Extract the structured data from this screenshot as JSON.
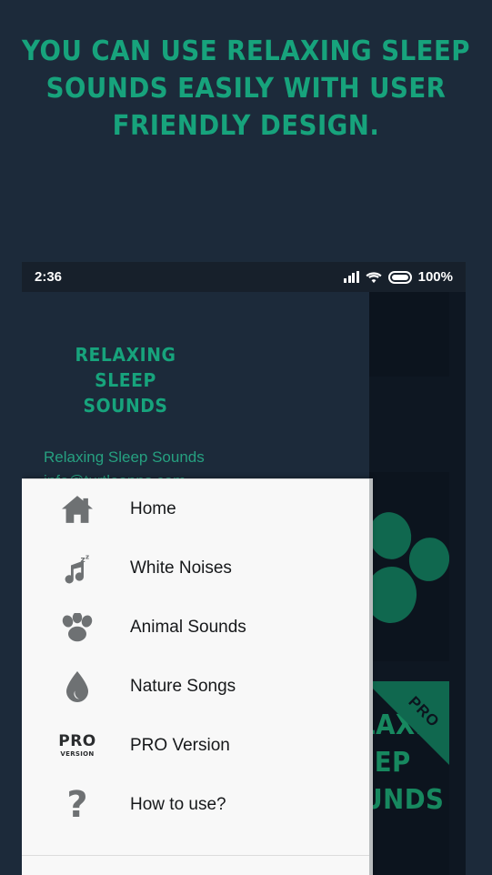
{
  "promo": {
    "headline_lines": [
      "YOU CAN USE RELAXING SLEEP",
      "SOUNDS EASILY WITH USER",
      "FRIENDLY DESIGN."
    ],
    "background_color": "#1c2a3a",
    "accent_color": "#17a37c"
  },
  "status_bar": {
    "time": "2:36",
    "battery_percent": "100%",
    "icons": [
      "signal-bars-icon",
      "wifi-icon",
      "battery-icon"
    ]
  },
  "drawer": {
    "app_title_lines": [
      "RELAXING",
      "SLEEP",
      "SOUNDS"
    ],
    "account_name": "Relaxing Sleep Sounds",
    "account_email": "info@turtleapps.com",
    "items": [
      {
        "label": "Home",
        "icon": "home-icon"
      },
      {
        "label": "White Noises",
        "icon": "music-note-sleep-icon"
      },
      {
        "label": "Animal Sounds",
        "icon": "paw-icon"
      },
      {
        "label": "Nature Songs",
        "icon": "water-drop-icon"
      },
      {
        "label": "PRO Version",
        "icon": "pro-version-icon"
      },
      {
        "label": "How to use?",
        "icon": "question-mark-icon"
      }
    ],
    "panel_color": "#f8f8f8",
    "header_color": "#1c2a3a"
  },
  "app_content": {
    "pro_card_lines": [
      "RELAXING",
      "SLEEP",
      "SOUNDS"
    ],
    "pro_ribbon_label": "PRO",
    "card_color": "#0c141e",
    "graphic_color": "#10684f"
  }
}
